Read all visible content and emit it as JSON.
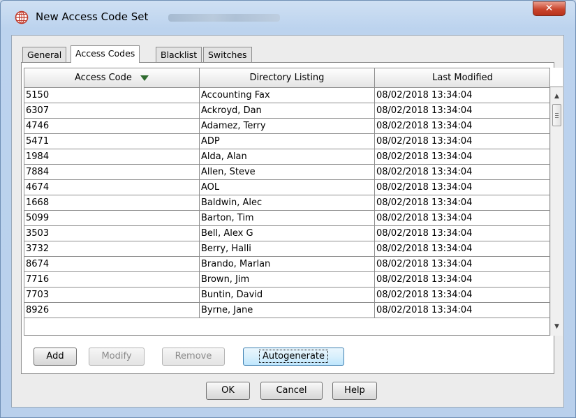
{
  "window": {
    "title": "New Access Code Set",
    "close_glyph": "✕",
    "accent_color": "#c0392b"
  },
  "tabs": [
    {
      "label": "General",
      "active": false
    },
    {
      "label": "Access Codes",
      "active": true
    },
    {
      "label": "Blacklist",
      "active": false
    },
    {
      "label": "Switches",
      "active": false
    }
  ],
  "table": {
    "headers": [
      "Access Code",
      "Directory Listing",
      "Last Modified"
    ],
    "sort_column": "Access Code",
    "sort_direction": "descending",
    "sort_icon_color": "#2f6b2f",
    "rows": [
      [
        "5150",
        "Accounting Fax",
        "08/02/2018 13:34:04"
      ],
      [
        "6307",
        "Ackroyd, Dan",
        "08/02/2018 13:34:04"
      ],
      [
        "4746",
        "Adamez, Terry",
        "08/02/2018 13:34:04"
      ],
      [
        "5471",
        "ADP",
        "08/02/2018 13:34:04"
      ],
      [
        "1984",
        "Alda, Alan",
        "08/02/2018 13:34:04"
      ],
      [
        "7884",
        "Allen, Steve",
        "08/02/2018 13:34:04"
      ],
      [
        "4674",
        "AOL",
        "08/02/2018 13:34:04"
      ],
      [
        "1668",
        "Baldwin, Alec",
        "08/02/2018 13:34:04"
      ],
      [
        "5099",
        "Barton, Tim",
        "08/02/2018 13:34:04"
      ],
      [
        "3503",
        "Bell, Alex G",
        "08/02/2018 13:34:04"
      ],
      [
        "3732",
        "Berry, Halli",
        "08/02/2018 13:34:04"
      ],
      [
        "8674",
        "Brando, Marlan",
        "08/02/2018 13:34:04"
      ],
      [
        "7716",
        "Brown, Jim",
        "08/02/2018 13:34:04"
      ],
      [
        "7703",
        "Buntin, David",
        "08/02/2018 13:34:04"
      ],
      [
        "8926",
        "Byrne, Jane",
        "08/02/2018 13:34:04"
      ]
    ]
  },
  "panel_buttons": {
    "add": "Add",
    "modify": "Modify",
    "remove": "Remove",
    "autogenerate": "Autogenerate"
  },
  "dialog_buttons": {
    "ok": "OK",
    "cancel": "Cancel",
    "help": "Help"
  }
}
